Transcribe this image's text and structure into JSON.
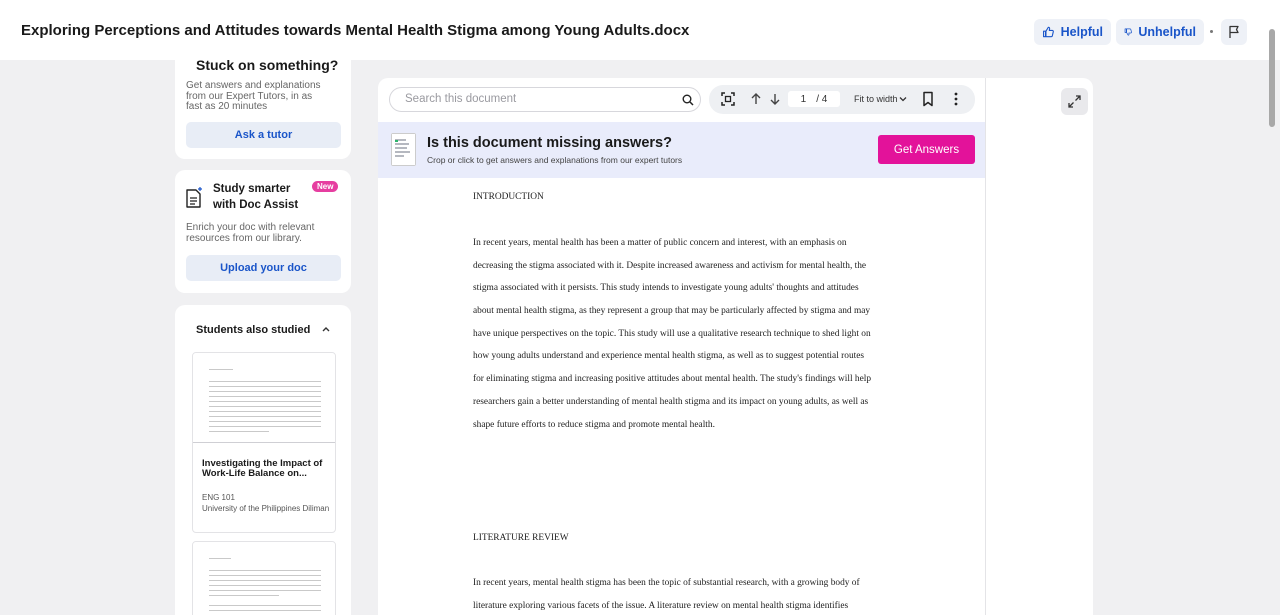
{
  "header": {
    "title": "Exploring Perceptions and Attitudes towards Mental Health Stigma among Young Adults.docx",
    "helpful_label": "Helpful",
    "unhelpful_label": "Unhelpful"
  },
  "sidebar": {
    "tutor": {
      "title": "Stuck on something?",
      "description": "Get answers and explanations from our Expert Tutors, in as fast as 20 minutes",
      "button": "Ask a tutor"
    },
    "assist": {
      "title": "Study smarter with Doc Assist",
      "badge": "New",
      "description": "Enrich your doc with relevant resources from our library.",
      "button": "Upload your doc"
    },
    "studied": {
      "title": "Students also studied",
      "docs": [
        {
          "title": "Investigating the Impact of Work-Life Balance on...",
          "course": "ENG 101",
          "school": "University of the Philippines Diliman"
        }
      ]
    }
  },
  "viewer": {
    "search_placeholder": "Search this document",
    "page_current": "1",
    "page_total": "/ 4",
    "fit_label": "Fit to width",
    "banner": {
      "title": "Is this document missing answers?",
      "subtitle": "Crop or click to get answers and explanations from our expert tutors",
      "button": "Get Answers"
    }
  },
  "document": {
    "heading1": "INTRODUCTION",
    "para1": [
      "In recent years, mental health has been a matter of public concern and interest, with an emphasis on",
      "decreasing the stigma associated with it. Despite increased awareness and activism for mental health, the",
      "stigma associated with it persists. This study intends to investigate young adults' thoughts and attitudes",
      "about mental health stigma, as they represent a group that may be particularly affected by stigma and may",
      "have unique perspectives on the topic. This study will use a qualitative research technique to shed light on",
      "how young adults understand and experience mental health stigma, as well as to suggest potential routes",
      "for eliminating stigma and increasing positive attitudes about mental health. The study's findings will help",
      "researchers gain a better understanding of mental health stigma and its impact on young adults, as well as",
      "shape future efforts to reduce stigma and promote mental health."
    ],
    "heading2": "LITERATURE REVIEW",
    "para2": [
      "In recent years, mental health stigma has been the topic of substantial research, with a growing body of",
      "literature exploring various facets of the issue. A literature review on mental health stigma identifies"
    ]
  },
  "colors": {
    "accent_blue": "#1a55c9",
    "brand_pink": "#e3129a",
    "banner_bg": "#e9ecfb"
  }
}
